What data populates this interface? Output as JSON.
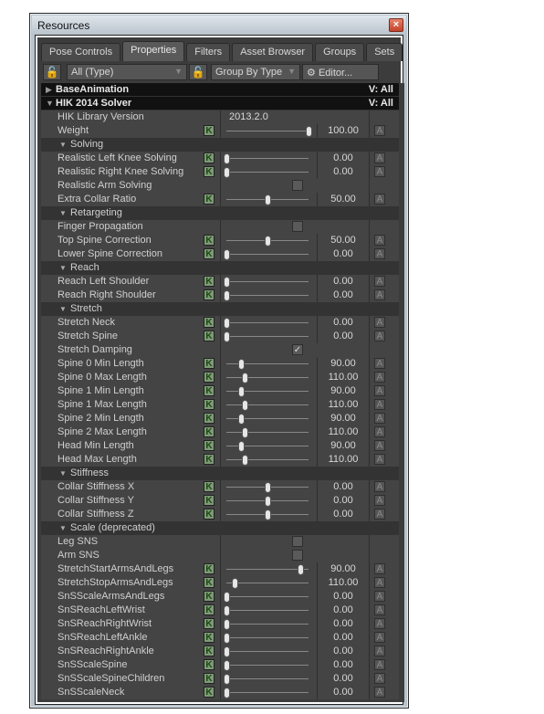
{
  "window": {
    "title": "Resources",
    "close_icon": "close-icon"
  },
  "tabs": [
    {
      "label": "Pose Controls",
      "active": false
    },
    {
      "label": "Properties",
      "active": true
    },
    {
      "label": "Filters",
      "active": false
    },
    {
      "label": "Asset Browser",
      "active": false
    },
    {
      "label": "Groups",
      "active": false
    },
    {
      "label": "Sets",
      "active": false
    }
  ],
  "toolbar": {
    "type_filter": "All (Type)",
    "group_by": "Group By Type",
    "editor_label": "Editor..."
  },
  "objects": [
    {
      "name": "BaseAnimation",
      "visibility": "V: All",
      "expanded": false
    },
    {
      "name": "HIK 2014 Solver",
      "visibility": "V: All",
      "expanded": true
    }
  ],
  "rows": [
    {
      "type": "text",
      "label": "HIK Library Version",
      "value": "2013.2.0"
    },
    {
      "type": "slider",
      "label": "Weight",
      "value": "100.00",
      "pos": 1.0
    },
    {
      "type": "section",
      "label": "Solving"
    },
    {
      "type": "slider",
      "label": "Realistic Left Knee Solving",
      "value": "0.00",
      "pos": 0.0
    },
    {
      "type": "slider",
      "label": "Realistic Right Knee Solving",
      "value": "0.00",
      "pos": 0.0
    },
    {
      "type": "check",
      "label": "Realistic Arm Solving",
      "checked": false
    },
    {
      "type": "slider",
      "label": "Extra Collar Ratio",
      "value": "50.00",
      "pos": 0.5
    },
    {
      "type": "section",
      "label": "Retargeting"
    },
    {
      "type": "check",
      "label": "Finger Propagation",
      "checked": false
    },
    {
      "type": "slider",
      "label": "Top Spine Correction",
      "value": "50.00",
      "pos": 0.5
    },
    {
      "type": "slider",
      "label": "Lower Spine Correction",
      "value": "0.00",
      "pos": 0.0
    },
    {
      "type": "section",
      "label": "Reach"
    },
    {
      "type": "slider",
      "label": "Reach Left Shoulder",
      "value": "0.00",
      "pos": 0.0
    },
    {
      "type": "slider",
      "label": "Reach Right Shoulder",
      "value": "0.00",
      "pos": 0.0
    },
    {
      "type": "section",
      "label": "Stretch"
    },
    {
      "type": "slider",
      "label": "Stretch Neck",
      "value": "0.00",
      "pos": 0.0
    },
    {
      "type": "slider",
      "label": "Stretch Spine",
      "value": "0.00",
      "pos": 0.0
    },
    {
      "type": "check",
      "label": "Stretch Damping",
      "checked": true
    },
    {
      "type": "slider",
      "label": "Spine 0 Min Length",
      "value": "90.00",
      "pos": 0.18
    },
    {
      "type": "slider",
      "label": "Spine 0 Max Length",
      "value": "110.00",
      "pos": 0.22
    },
    {
      "type": "slider",
      "label": "Spine 1 Min Length",
      "value": "90.00",
      "pos": 0.18
    },
    {
      "type": "slider",
      "label": "Spine 1 Max Length",
      "value": "110.00",
      "pos": 0.22
    },
    {
      "type": "slider",
      "label": "Spine 2 Min Length",
      "value": "90.00",
      "pos": 0.18
    },
    {
      "type": "slider",
      "label": "Spine 2 Max Length",
      "value": "110.00",
      "pos": 0.22
    },
    {
      "type": "slider",
      "label": "Head Min Length",
      "value": "90.00",
      "pos": 0.18
    },
    {
      "type": "slider",
      "label": "Head Max Length",
      "value": "110.00",
      "pos": 0.22
    },
    {
      "type": "section",
      "label": "Stiffness"
    },
    {
      "type": "slider",
      "label": "Collar Stiffness X",
      "value": "0.00",
      "pos": 0.5
    },
    {
      "type": "slider",
      "label": "Collar Stiffness Y",
      "value": "0.00",
      "pos": 0.5
    },
    {
      "type": "slider",
      "label": "Collar Stiffness Z",
      "value": "0.00",
      "pos": 0.5
    },
    {
      "type": "section",
      "label": "Scale (deprecated)"
    },
    {
      "type": "check",
      "label": "Leg SNS",
      "checked": false
    },
    {
      "type": "check",
      "label": "Arm SNS",
      "checked": false
    },
    {
      "type": "slider",
      "label": "StretchStartArmsAndLegs",
      "value": "90.00",
      "pos": 0.9
    },
    {
      "type": "slider",
      "label": "StretchStopArmsAndLegs",
      "value": "110.00",
      "pos": 0.1
    },
    {
      "type": "slider",
      "label": "SnSScaleArmsAndLegs",
      "value": "0.00",
      "pos": 0.0
    },
    {
      "type": "slider",
      "label": "SnSReachLeftWrist",
      "value": "0.00",
      "pos": 0.0
    },
    {
      "type": "slider",
      "label": "SnSReachRightWrist",
      "value": "0.00",
      "pos": 0.0
    },
    {
      "type": "slider",
      "label": "SnSReachLeftAnkle",
      "value": "0.00",
      "pos": 0.0
    },
    {
      "type": "slider",
      "label": "SnSReachRightAnkle",
      "value": "0.00",
      "pos": 0.0
    },
    {
      "type": "slider",
      "label": "SnSScaleSpine",
      "value": "0.00",
      "pos": 0.0
    },
    {
      "type": "slider",
      "label": "SnSScaleSpineChildren",
      "value": "0.00",
      "pos": 0.0
    },
    {
      "type": "slider",
      "label": "SnSScaleNeck",
      "value": "0.00",
      "pos": 0.0
    }
  ],
  "glyphs": {
    "key": "K",
    "anim": "A",
    "check": "✓"
  }
}
